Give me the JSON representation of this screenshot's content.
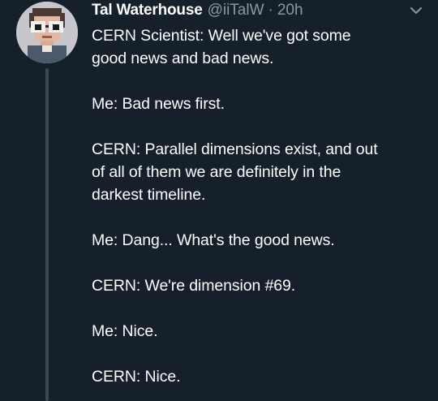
{
  "tweet": {
    "author_name": "Tal Waterhouse",
    "author_handle": "@iiTalW",
    "separator": "·",
    "timestamp": "20h",
    "avatar_icon": "pixel-art-avatar",
    "menu_icon": "chevron-down-icon",
    "paragraphs": [
      "CERN Scientist: Well we've got some\ngood news and bad news.",
      "Me: Bad news first.",
      "CERN: Parallel dimensions exist, and out\nof all of them we are definitely in the\ndarkest timeline.",
      "Me: Dang... What's the good news.",
      "CERN: We're dimension #69.",
      "Me: Nice.",
      "CERN: Nice."
    ]
  },
  "colors": {
    "background": "#15202b",
    "secondary_text": "#8899a6",
    "primary_text": "#ffffff"
  }
}
